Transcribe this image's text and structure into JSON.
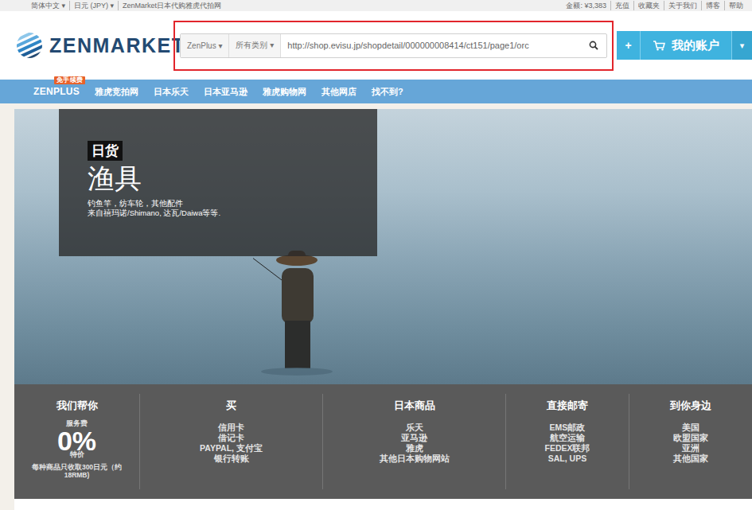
{
  "top_bar": {
    "left": [
      "简体中文 ▾",
      "日元 (JPY) ▾",
      "ZenMarket日本代购雅虎代拍网"
    ],
    "right": [
      "金额: ¥3,383",
      "充值",
      "收藏夹",
      "关于我们",
      "博客",
      "帮助"
    ]
  },
  "logo": {
    "text": "ZENMARKET"
  },
  "search": {
    "scope": "ZenPlus ▾",
    "category": "所有类别 ▾",
    "value": "http://shop.evisu.jp/shopdetail/000000008414/ct151/page1/orc"
  },
  "account": {
    "plus": "+",
    "label": "我的账户",
    "caret": "▾"
  },
  "nav": [
    {
      "label": "ZENPLUS",
      "badge": "免手续费"
    },
    {
      "label": "雅虎竞拍网"
    },
    {
      "label": "日本乐天"
    },
    {
      "label": "日本亚马逊"
    },
    {
      "label": "雅虎购物网"
    },
    {
      "label": "其他网店"
    },
    {
      "label": "找不到?"
    }
  ],
  "hero": {
    "tag": "日货",
    "title": "渔具",
    "lines": [
      "钓鱼竿，纺车轮，其他配件",
      "来自禧玛诺/Shimano, 达瓦/Daiwa等等."
    ]
  },
  "features": [
    {
      "kind": "promo",
      "title": "我们帮你",
      "caption": "服务费",
      "big": "0%",
      "note": "特价",
      "detail": "每种商品只收取300日元（约18RMB)"
    },
    {
      "kind": "list",
      "title": "买",
      "items": [
        "信用卡",
        "借记卡",
        "PAYPAL, 支付宝",
        "银行转账"
      ]
    },
    {
      "kind": "list",
      "title": "日本商品",
      "items": [
        "乐天",
        "亚马逊",
        "雅虎",
        "其他日本购物网站"
      ]
    },
    {
      "kind": "list",
      "title": "直接邮寄",
      "items": [
        "EMS邮政",
        "航空运输",
        "FEDEX联邦",
        "SAL, UPS"
      ]
    },
    {
      "kind": "list",
      "title": "到你身边",
      "items": [
        "美国",
        "欧盟国家",
        "亚洲",
        "其他国家"
      ]
    }
  ]
}
